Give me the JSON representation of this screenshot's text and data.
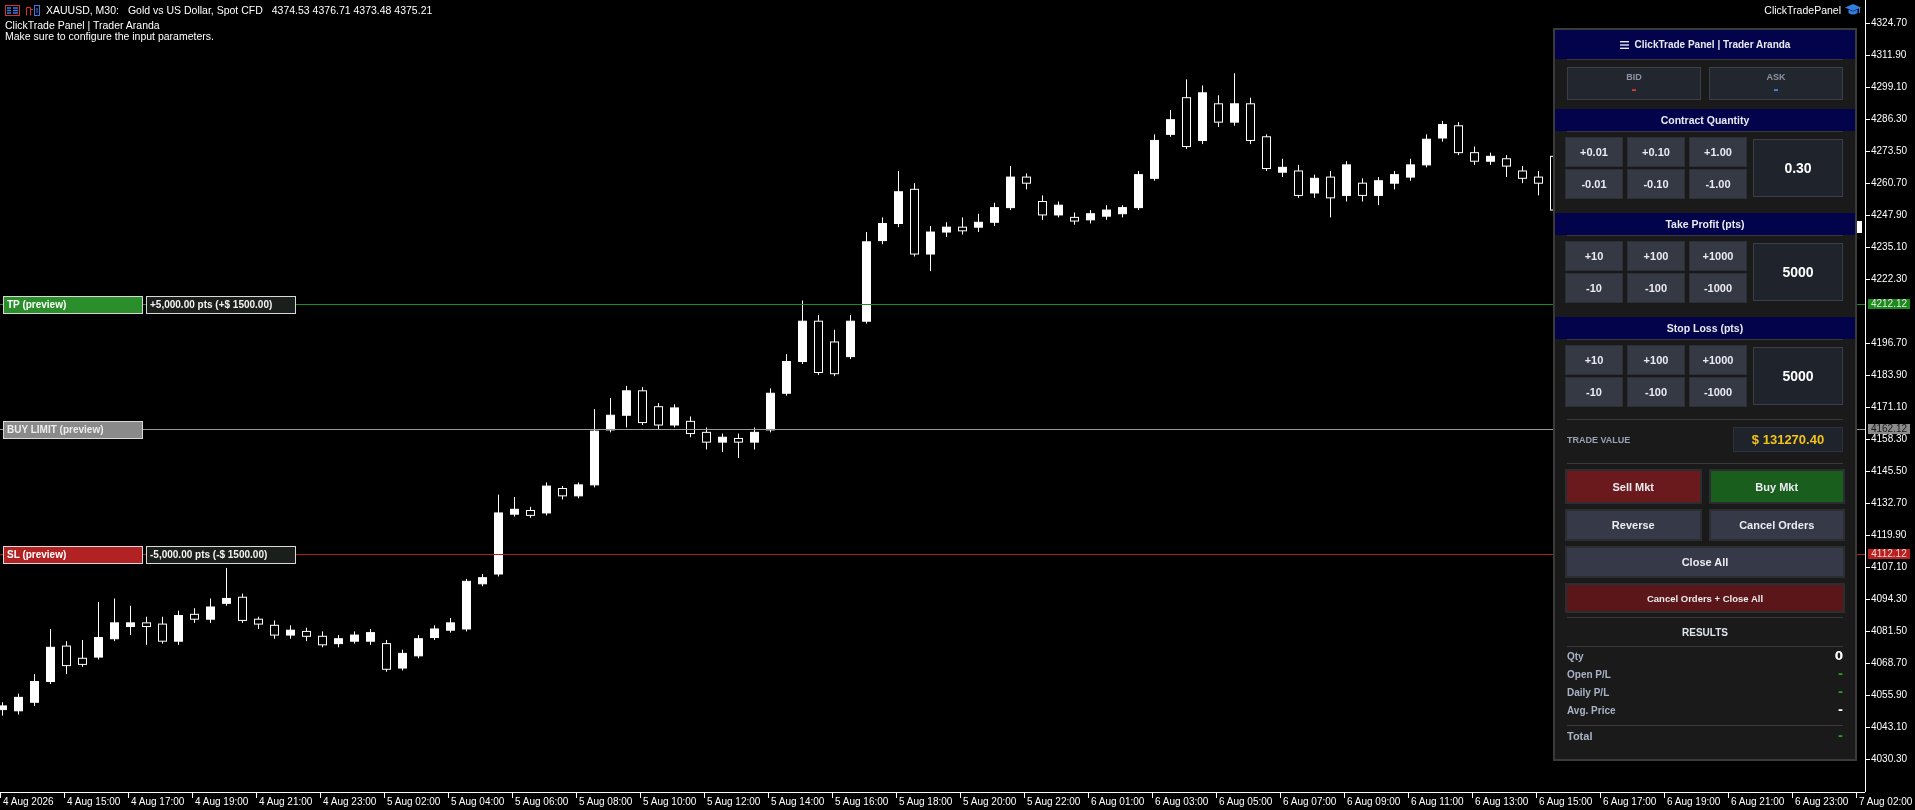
{
  "chart_header": {
    "symbol": "XAUUSD, M30:",
    "description": "Gold vs US Dollar, Spot CFD",
    "ohlc": "4374.53 4376.71 4373.48 4375.21",
    "indicator": "ClickTrade Panel | Trader Aranda",
    "message": "Make sure to configure the input parameters."
  },
  "expert_badge": {
    "label": "ClickTradePanel"
  },
  "price_levels": [
    {
      "kind": "take_profit",
      "label": "TP (preview)",
      "info": "+5,000.00 pts (+$ 1500.00)",
      "price": "4212.12"
    },
    {
      "kind": "entry",
      "label": "BUY LIMIT (preview)",
      "price": "4162.12"
    },
    {
      "kind": "stop_loss",
      "label": "SL (preview)",
      "info": "-5,000.00 pts (-$ 1500.00)",
      "price": "4112.12"
    }
  ],
  "price_axis": {
    "labels": [
      "4324.70",
      "4311.90",
      "4299.10",
      "4286.30",
      "4273.50",
      "4260.70",
      "4247.90",
      "4235.10",
      "4222.30",
      "4196.70",
      "4183.90",
      "4171.10",
      "4158.30",
      "4145.50",
      "4132.70",
      "4119.90",
      "4107.10",
      "4094.30",
      "4081.50",
      "4068.70",
      "4055.90",
      "4043.10",
      "4030.30"
    ]
  },
  "time_axis": {
    "labels": [
      "4 Aug 2026",
      "4 Aug 15:00",
      "4 Aug 17:00",
      "4 Aug 19:00",
      "4 Aug 21:00",
      "4 Aug 23:00",
      "5 Aug 02:00",
      "5 Aug 04:00",
      "5 Aug 06:00",
      "5 Aug 08:00",
      "5 Aug 10:00",
      "5 Aug 12:00",
      "5 Aug 14:00",
      "5 Aug 16:00",
      "5 Aug 18:00",
      "5 Aug 20:00",
      "5 Aug 22:00",
      "6 Aug 01:00",
      "6 Aug 03:00",
      "6 Aug 05:00",
      "6 Aug 07:00",
      "6 Aug 09:00",
      "6 Aug 11:00",
      "6 Aug 13:00",
      "6 Aug 15:00",
      "6 Aug 17:00",
      "6 Aug 19:00",
      "6 Aug 21:00",
      "6 Aug 23:00",
      "7 Aug 02:00"
    ]
  },
  "panel": {
    "title": "ClickTrade Panel | Trader Aranda",
    "quotes": [
      {
        "label": "BID",
        "value": "-",
        "color": "#e03c3c"
      },
      {
        "label": "ASK",
        "value": "-",
        "color": "#3c8ee6"
      }
    ],
    "steppers": [
      {
        "title": "Contract Quantity",
        "buttons": [
          "+0.01",
          "+0.10",
          "+1.00",
          "-0.01",
          "-0.10",
          "-1.00"
        ],
        "value": "0.30"
      },
      {
        "title": "Take Profit (pts)",
        "buttons": [
          "+10",
          "+100",
          "+1000",
          "-10",
          "-100",
          "-1000"
        ],
        "value": "5000"
      },
      {
        "title": "Stop Loss (pts)",
        "buttons": [
          "+10",
          "+100",
          "+1000",
          "-10",
          "-100",
          "-1000"
        ],
        "value": "5000"
      }
    ],
    "trade_value": {
      "label": "TRADE VALUE",
      "value": "$ 131270.40"
    },
    "action_rows": [
      [
        {
          "label": "Sell Mkt",
          "kind": "sell"
        },
        {
          "label": "Buy Mkt",
          "kind": "buy"
        }
      ],
      [
        {
          "label": "Reverse",
          "kind": "neutral"
        },
        {
          "label": "Cancel Orders",
          "kind": "neutral"
        }
      ],
      [
        {
          "label": "Close All",
          "kind": "neutral"
        }
      ],
      [
        {
          "label": "Cancel Orders + Close All",
          "kind": "danger"
        }
      ]
    ],
    "results": {
      "title": "RESULTS",
      "rows": [
        {
          "label": "Qty",
          "value": "0",
          "color": "#ffffff"
        },
        {
          "label": "Open P/L",
          "value": "-",
          "color": "#22a622"
        },
        {
          "label": "Daily P/L",
          "value": "-",
          "color": "#22a622"
        },
        {
          "label": "Avg. Price",
          "value": "-",
          "color": "#ffffff"
        }
      ],
      "total": {
        "label": "Total",
        "value": "-",
        "color": "#22a622"
      }
    }
  }
}
